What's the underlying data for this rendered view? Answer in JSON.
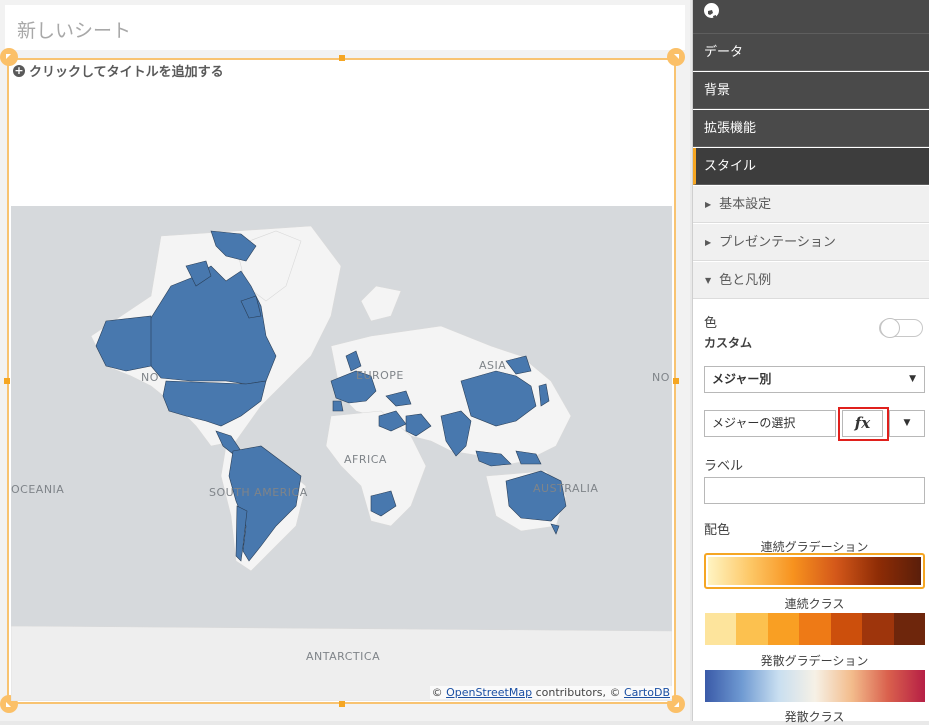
{
  "sheet": {
    "title": "新しいシート",
    "add_title": "クリックしてタイトルを追加する"
  },
  "map": {
    "labels": [
      "NO",
      "ASIA",
      "EUROPE",
      "AFRICA",
      "SOUTH AMERICA",
      "OCEANIA",
      "AUSTRALIA",
      "ANTARCTICA"
    ],
    "attribution": {
      "prefix": "© ",
      "osm": "OpenStreetMap",
      "mid": " contributors, © ",
      "carto": "CartoDB"
    },
    "colors": {
      "ocean": "#d6d9dc",
      "land": "#f4f4f4",
      "highlight": "#4878ae"
    }
  },
  "panel": {
    "top_icon": "globe-icon",
    "nav": [
      "データ",
      "背景",
      "拡張機能",
      "スタイル"
    ],
    "accordion": [
      "基本設定",
      "プレゼンテーション",
      "色と凡例"
    ],
    "color_label": "色",
    "custom_label": "カスタム",
    "measure_select": "メジャー別",
    "measure_placeholder": "メジャーの選択",
    "fx_label": "fx",
    "label_label": "ラベル",
    "palette_label": "配色",
    "palettes": [
      "連続グラデーション",
      "連続クラス",
      "発散グラデーション",
      "発散クラス"
    ],
    "accent": "#f5a623"
  }
}
